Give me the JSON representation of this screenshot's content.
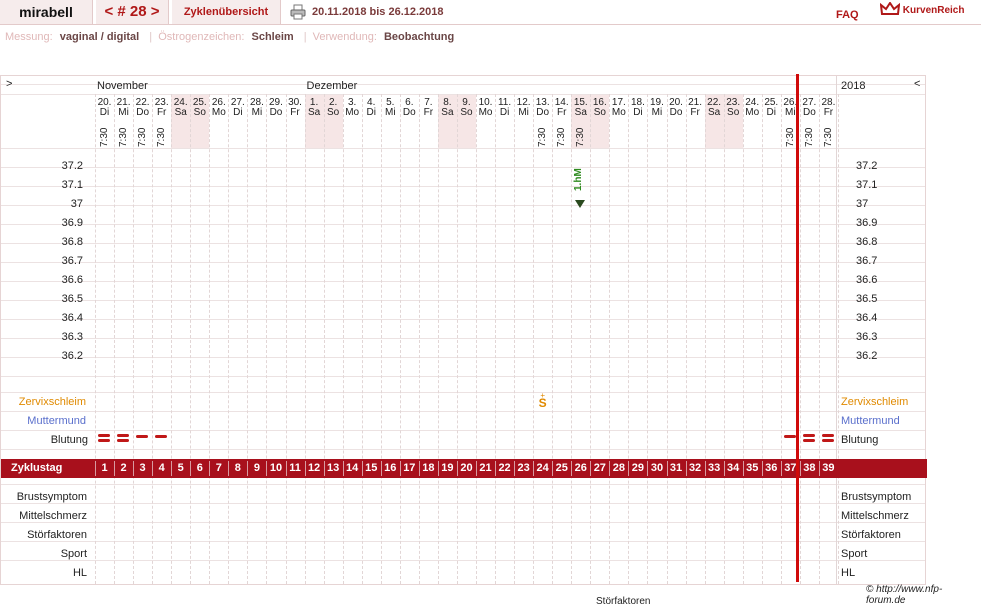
{
  "header": {
    "app_name": "mirabell",
    "cycle_prev": "<",
    "cycle_number": "# 28",
    "cycle_next": ">",
    "overview_label": "Zyklenübersicht",
    "date_range": "20.11.2018 bis 26.12.2018",
    "faq_label": "FAQ",
    "logo_text": "KurvenReich"
  },
  "subheader": {
    "messung_label": "Messung:",
    "messung_value": "vaginal / digital",
    "oestrogen_label": "Östrogenzeichen:",
    "oestrogen_value": "Schleim",
    "verwendung_label": "Verwendung:",
    "verwendung_value": "Beobachtung"
  },
  "nav": {
    "left_arrow": ">",
    "right_arrow": "<",
    "year": "2018"
  },
  "months": [
    {
      "label": "November",
      "col": 0
    },
    {
      "label": "Dezember",
      "col": 11
    }
  ],
  "days": [
    {
      "d": "20.",
      "w": "Di",
      "t": "7:30",
      "cd": "1",
      "we": false
    },
    {
      "d": "21.",
      "w": "Mi",
      "t": "7:30",
      "cd": "2",
      "we": false
    },
    {
      "d": "22.",
      "w": "Do",
      "t": "7:30",
      "cd": "3",
      "we": false
    },
    {
      "d": "23.",
      "w": "Fr",
      "t": "7:30",
      "cd": "4",
      "we": false
    },
    {
      "d": "24.",
      "w": "Sa",
      "t": "",
      "cd": "5",
      "we": true
    },
    {
      "d": "25.",
      "w": "So",
      "t": "",
      "cd": "6",
      "we": true
    },
    {
      "d": "26.",
      "w": "Mo",
      "t": "",
      "cd": "7",
      "we": false
    },
    {
      "d": "27.",
      "w": "Di",
      "t": "",
      "cd": "8",
      "we": false
    },
    {
      "d": "28.",
      "w": "Mi",
      "t": "",
      "cd": "9",
      "we": false
    },
    {
      "d": "29.",
      "w": "Do",
      "t": "",
      "cd": "10",
      "we": false
    },
    {
      "d": "30.",
      "w": "Fr",
      "t": "",
      "cd": "11",
      "we": false
    },
    {
      "d": "1.",
      "w": "Sa",
      "t": "",
      "cd": "12",
      "we": true
    },
    {
      "d": "2.",
      "w": "So",
      "t": "",
      "cd": "13",
      "we": true
    },
    {
      "d": "3.",
      "w": "Mo",
      "t": "",
      "cd": "14",
      "we": false
    },
    {
      "d": "4.",
      "w": "Di",
      "t": "",
      "cd": "15",
      "we": false
    },
    {
      "d": "5.",
      "w": "Mi",
      "t": "",
      "cd": "16",
      "we": false
    },
    {
      "d": "6.",
      "w": "Do",
      "t": "",
      "cd": "17",
      "we": false
    },
    {
      "d": "7.",
      "w": "Fr",
      "t": "",
      "cd": "18",
      "we": false
    },
    {
      "d": "8.",
      "w": "Sa",
      "t": "",
      "cd": "19",
      "we": true
    },
    {
      "d": "9.",
      "w": "So",
      "t": "",
      "cd": "20",
      "we": true
    },
    {
      "d": "10.",
      "w": "Mo",
      "t": "",
      "cd": "21",
      "we": false
    },
    {
      "d": "11.",
      "w": "Di",
      "t": "",
      "cd": "22",
      "we": false
    },
    {
      "d": "12.",
      "w": "Mi",
      "t": "",
      "cd": "23",
      "we": false
    },
    {
      "d": "13.",
      "w": "Do",
      "t": "7:30",
      "cd": "24",
      "we": false
    },
    {
      "d": "14.",
      "w": "Fr",
      "t": "7:30",
      "cd": "25",
      "we": false
    },
    {
      "d": "15.",
      "w": "Sa",
      "t": "7:30",
      "cd": "26",
      "we": true
    },
    {
      "d": "16.",
      "w": "So",
      "t": "",
      "cd": "27",
      "we": true
    },
    {
      "d": "17.",
      "w": "Mo",
      "t": "",
      "cd": "28",
      "we": false
    },
    {
      "d": "18.",
      "w": "Di",
      "t": "",
      "cd": "29",
      "we": false
    },
    {
      "d": "19.",
      "w": "Mi",
      "t": "",
      "cd": "30",
      "we": false
    },
    {
      "d": "20.",
      "w": "Do",
      "t": "",
      "cd": "31",
      "we": false
    },
    {
      "d": "21.",
      "w": "Fr",
      "t": "",
      "cd": "32",
      "we": false
    },
    {
      "d": "22.",
      "w": "Sa",
      "t": "",
      "cd": "33",
      "we": true
    },
    {
      "d": "23.",
      "w": "So",
      "t": "",
      "cd": "34",
      "we": true
    },
    {
      "d": "24.",
      "w": "Mo",
      "t": "",
      "cd": "35",
      "we": false
    },
    {
      "d": "25.",
      "w": "Di",
      "t": "",
      "cd": "36",
      "we": false
    },
    {
      "d": "26.",
      "w": "Mi",
      "t": "7:30",
      "cd": "37",
      "we": false
    },
    {
      "d": "27.",
      "w": "Do",
      "t": "7:30",
      "cd": "38",
      "we": false
    },
    {
      "d": "28.",
      "w": "Fr",
      "t": "7:30",
      "cd": "39",
      "we": false
    }
  ],
  "temperatures": [
    "37.2",
    "37.1",
    "37",
    "36.9",
    "36.8",
    "36.7",
    "36.6",
    "36.5",
    "36.4",
    "36.3",
    "36.2"
  ],
  "rows": {
    "zervix": "Zervixschleim",
    "muttermund": "Muttermund",
    "blutung": "Blutung",
    "zyklustag": "Zyklustag",
    "brust": "Brustsymptom",
    "mittel": "Mittelschmerz",
    "stoer": "Störfaktoren",
    "sport": "Sport",
    "hl": "HL"
  },
  "marks": {
    "hm_label": "1.hM",
    "hm_col": 25,
    "zervix_mark": "S",
    "zervix_mark_top": "+",
    "zervix_col": 23,
    "bleeding": [
      {
        "col": 0,
        "strength": "heavy"
      },
      {
        "col": 1,
        "strength": "heavy"
      },
      {
        "col": 2,
        "strength": "light"
      },
      {
        "col": 3,
        "strength": "light"
      },
      {
        "col": 36,
        "strength": "light"
      },
      {
        "col": 37,
        "strength": "heavy"
      },
      {
        "col": 38,
        "strength": "heavy"
      }
    ]
  },
  "colors": {
    "accent": "#b01818",
    "zyklus_bar": "#a8101c",
    "zervix": "#e08a00",
    "muttermund": "#5a6fcc",
    "hm": "#2e8a1e"
  },
  "footer": {
    "copyright": "© http://www.nfp-forum.de",
    "bottom_text": "Störfaktoren"
  }
}
